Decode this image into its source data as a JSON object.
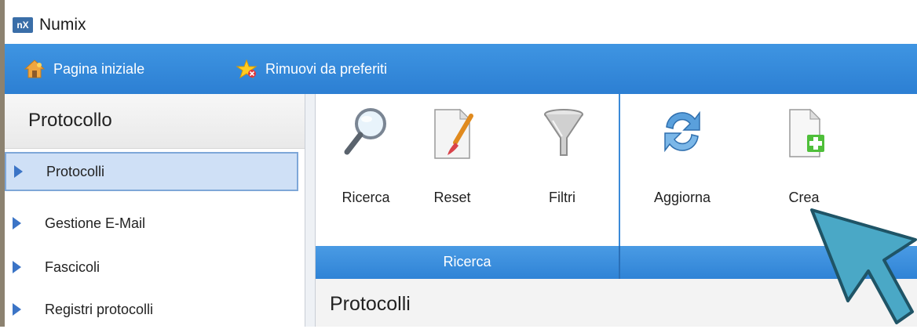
{
  "window": {
    "title": "Numix",
    "logo_text": "nX"
  },
  "navbar": {
    "home_label": "Pagina iniziale",
    "home_icon": "house-icon",
    "favorites_label": "Rimuovi da preferiti",
    "favorites_icon": "star-remove-icon"
  },
  "sidebar": {
    "title": "Protocollo",
    "items": [
      {
        "label": "Protocolli",
        "selected": true
      },
      {
        "label": "Gestione E-Mail"
      },
      {
        "label": "Fascicoli"
      },
      {
        "label": "Registri protocolli"
      }
    ]
  },
  "ribbon": {
    "tools": [
      {
        "label": "Ricerca",
        "icon": "magnifier-icon"
      },
      {
        "label": "Reset",
        "icon": "eraser-brush-icon"
      },
      {
        "label": "Filtri",
        "icon": "funnel-icon"
      },
      {
        "label": "Aggiorna",
        "icon": "refresh-icon"
      },
      {
        "label": "Crea",
        "icon": "new-document-icon"
      }
    ],
    "group_label": "Ricerca"
  },
  "content": {
    "title": "Protocolli"
  },
  "colors": {
    "nav_blue": "#2c7fd3",
    "cursor_teal": "#4aa8c6",
    "selection": "#cfe0f6"
  }
}
